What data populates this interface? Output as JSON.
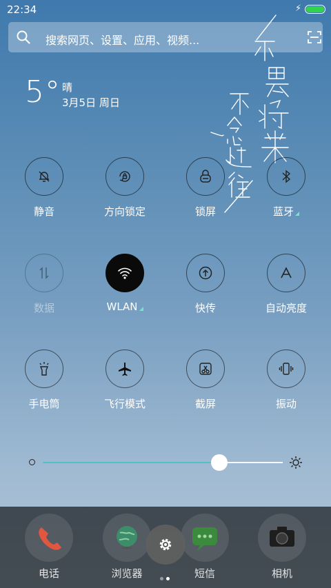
{
  "status_bar": {
    "time": "22:34",
    "charging_icon": "lightning-bolt-icon",
    "battery_color": "#32d44d"
  },
  "search": {
    "placeholder": "搜索网页、设置、应用、视频...",
    "search_icon": "magnifier-icon",
    "scan_icon": "scan-icon"
  },
  "weather": {
    "temperature": "5°",
    "condition": "晴",
    "date": "3月5日 周日"
  },
  "quick_toggles": [
    {
      "label": "静音",
      "icon": "bell-muted-icon",
      "active": false
    },
    {
      "label": "方向锁定",
      "icon": "rotation-lock-icon",
      "active": false
    },
    {
      "label": "锁屏",
      "icon": "lock-icon",
      "active": false
    },
    {
      "label": "蓝牙",
      "icon": "bluetooth-icon",
      "active": false
    },
    {
      "label": "数据",
      "icon": "mobile-data-icon",
      "active": false,
      "disabled": true
    },
    {
      "label": "WLAN",
      "icon": "wifi-icon",
      "active": true
    },
    {
      "label": "快传",
      "icon": "quick-transfer-icon",
      "active": false
    },
    {
      "label": "自动亮度",
      "icon": "auto-brightness-icon",
      "active": false
    },
    {
      "label": "手电筒",
      "icon": "flashlight-icon",
      "active": false
    },
    {
      "label": "飞行模式",
      "icon": "airplane-icon",
      "active": false
    },
    {
      "label": "截屏",
      "icon": "screenshot-icon",
      "active": false
    },
    {
      "label": "振动",
      "icon": "vibrate-icon",
      "active": false
    }
  ],
  "brightness": {
    "level": 0.7,
    "track_color": "#4fc2c2"
  },
  "dock": {
    "apps": [
      {
        "label": "电话",
        "icon": "phone-icon"
      },
      {
        "label": "浏览器",
        "icon": "browser-globe-icon"
      },
      {
        "label": "短信",
        "icon": "message-icon"
      },
      {
        "label": "相机",
        "icon": "camera-icon"
      }
    ],
    "settings_icon": "gear-icon",
    "page_count": 2,
    "current_page": 2
  }
}
